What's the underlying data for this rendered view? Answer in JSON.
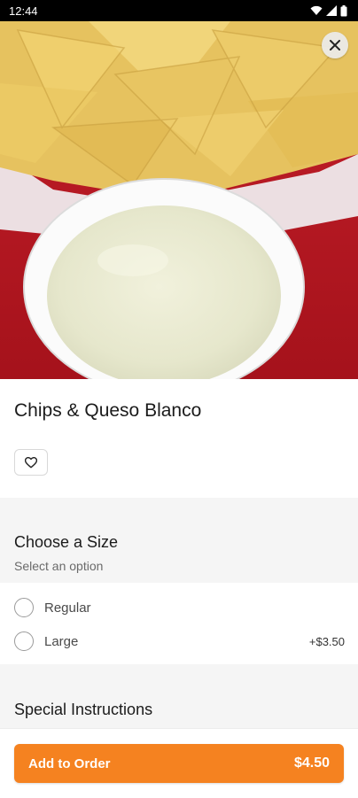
{
  "status_bar": {
    "time": "12:44"
  },
  "item": {
    "title": "Chips & Queso Blanco"
  },
  "size_section": {
    "title": "Choose a Size",
    "subtitle": "Select an option",
    "options": [
      {
        "label": "Regular",
        "price": ""
      },
      {
        "label": "Large",
        "price": "+$3.50"
      }
    ]
  },
  "instructions": {
    "title": "Special Instructions"
  },
  "footer": {
    "button_label": "Add to Order",
    "button_price": "$4.50"
  },
  "icons": {
    "close": "close-icon",
    "favorite": "heart-outline-icon",
    "wifi": "wifi-icon",
    "signal": "signal-icon",
    "battery": "battery-icon"
  },
  "colors": {
    "accent": "#f58220",
    "section_bg": "#f5f5f5"
  }
}
